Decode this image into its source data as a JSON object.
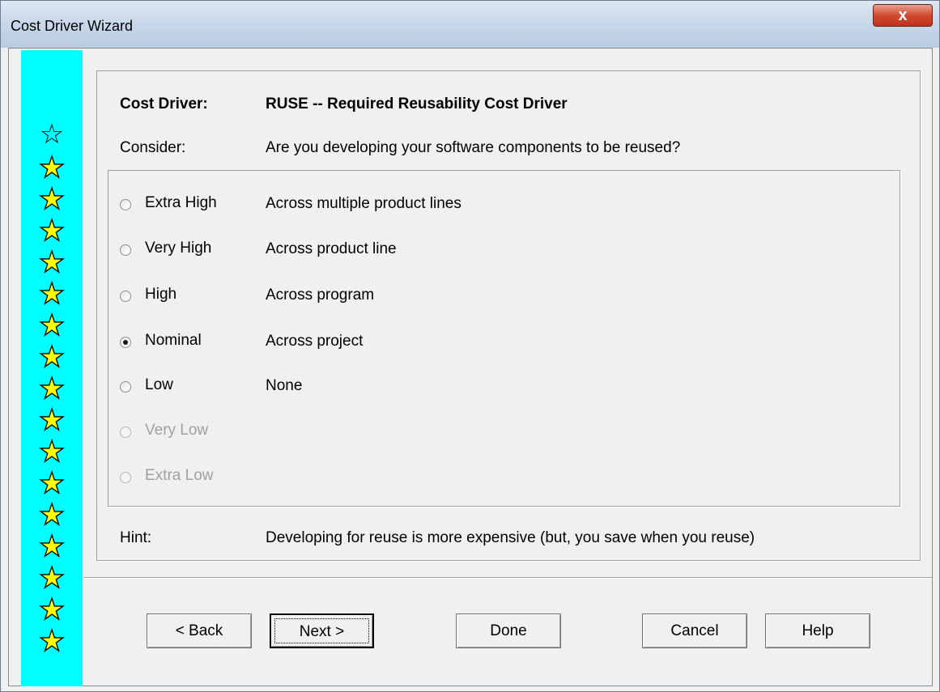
{
  "window": {
    "title": "Cost Driver Wizard",
    "close_label": "x"
  },
  "stars": {
    "filled_count": 15,
    "outline_count": 1
  },
  "header": {
    "cost_driver_label": "Cost Driver:",
    "cost_driver_value": "RUSE -- Required Reusability Cost Driver",
    "consider_label": "Consider:",
    "consider_value": "Are you developing your software components to be reused?"
  },
  "options": [
    {
      "label": "Extra High",
      "description": "Across multiple product lines",
      "selected": false,
      "enabled": true
    },
    {
      "label": "Very High",
      "description": "Across product line",
      "selected": false,
      "enabled": true
    },
    {
      "label": "High",
      "description": "Across program",
      "selected": false,
      "enabled": true
    },
    {
      "label": "Nominal",
      "description": "Across project",
      "selected": true,
      "enabled": true
    },
    {
      "label": "Low",
      "description": "None",
      "selected": false,
      "enabled": true
    },
    {
      "label": "Very Low",
      "description": "",
      "selected": false,
      "enabled": false
    },
    {
      "label": "Extra Low",
      "description": "",
      "selected": false,
      "enabled": false
    }
  ],
  "hint": {
    "label": "Hint:",
    "value": "Developing for reuse is more expensive (but, you save when you reuse)"
  },
  "buttons": {
    "back": "< Back",
    "next": "Next >",
    "done": "Done",
    "cancel": "Cancel",
    "help": "Help"
  }
}
